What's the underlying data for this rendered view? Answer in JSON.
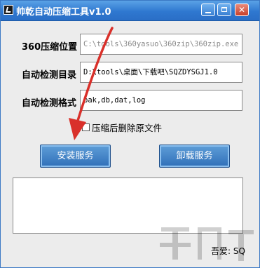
{
  "window": {
    "title": "帅乾自动压缩工具v1.0"
  },
  "form": {
    "path_label": "360压缩位置",
    "path_value": "C:\\tools\\360yasuo\\360zip\\360zip.exe",
    "dir_label": "自动检测目录",
    "dir_value": "D:\\tools\\桌面\\下载吧\\SQZDYSGJ1.0",
    "format_label": "自动检测格式",
    "format_value": "bak,db,dat,log",
    "delete_checkbox_label": "压缩后删除原文件",
    "delete_checked": false
  },
  "buttons": {
    "install_label": "安装服务",
    "uninstall_label": "卸载服务"
  },
  "log": {
    "content": ""
  },
  "footer": {
    "author": "吾爱: SQ"
  },
  "colors": {
    "titlebar": "#2f78d0",
    "button": "#2f6fb8",
    "arrow": "#d9302a"
  }
}
